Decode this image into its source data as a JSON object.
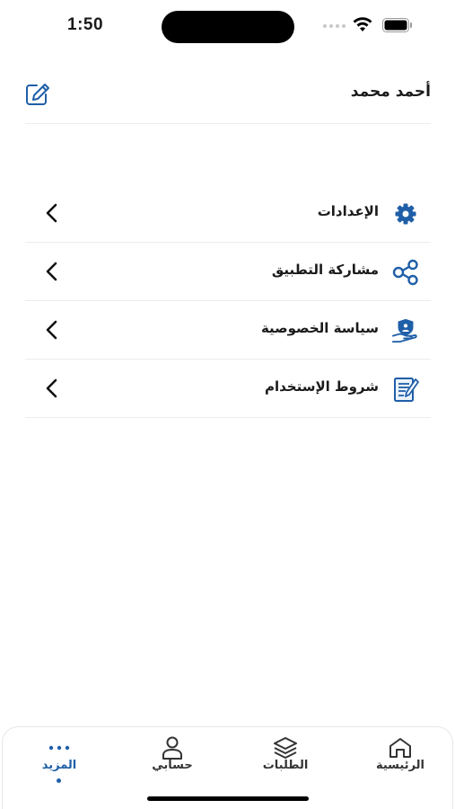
{
  "status_bar": {
    "time": "1:50",
    "icons": [
      "signal-dots-icon",
      "wifi-icon",
      "battery-icon"
    ]
  },
  "profile": {
    "name": "أحمد محمد",
    "edit_icon": "edit-icon"
  },
  "menu": {
    "items": [
      {
        "label": "الإعدادات",
        "icon": "gear-icon"
      },
      {
        "label": "مشاركة التطبيق",
        "icon": "share-icon"
      },
      {
        "label": "سياسة الخصوصية",
        "icon": "privacy-shield-icon"
      },
      {
        "label": "شروط الإستخدام",
        "icon": "terms-document-icon"
      }
    ]
  },
  "bottom_nav": {
    "items": [
      {
        "label": "الرئيسية",
        "icon": "home-icon"
      },
      {
        "label": "الطلبات",
        "icon": "layers-icon"
      },
      {
        "label": "حسابي",
        "icon": "user-icon"
      },
      {
        "label": "المزيد",
        "icon": "more-dots-icon",
        "active": true
      }
    ]
  },
  "colors": {
    "accent": "#1f5fa8",
    "text": "#1a1a1a",
    "divider": "#ececec"
  }
}
